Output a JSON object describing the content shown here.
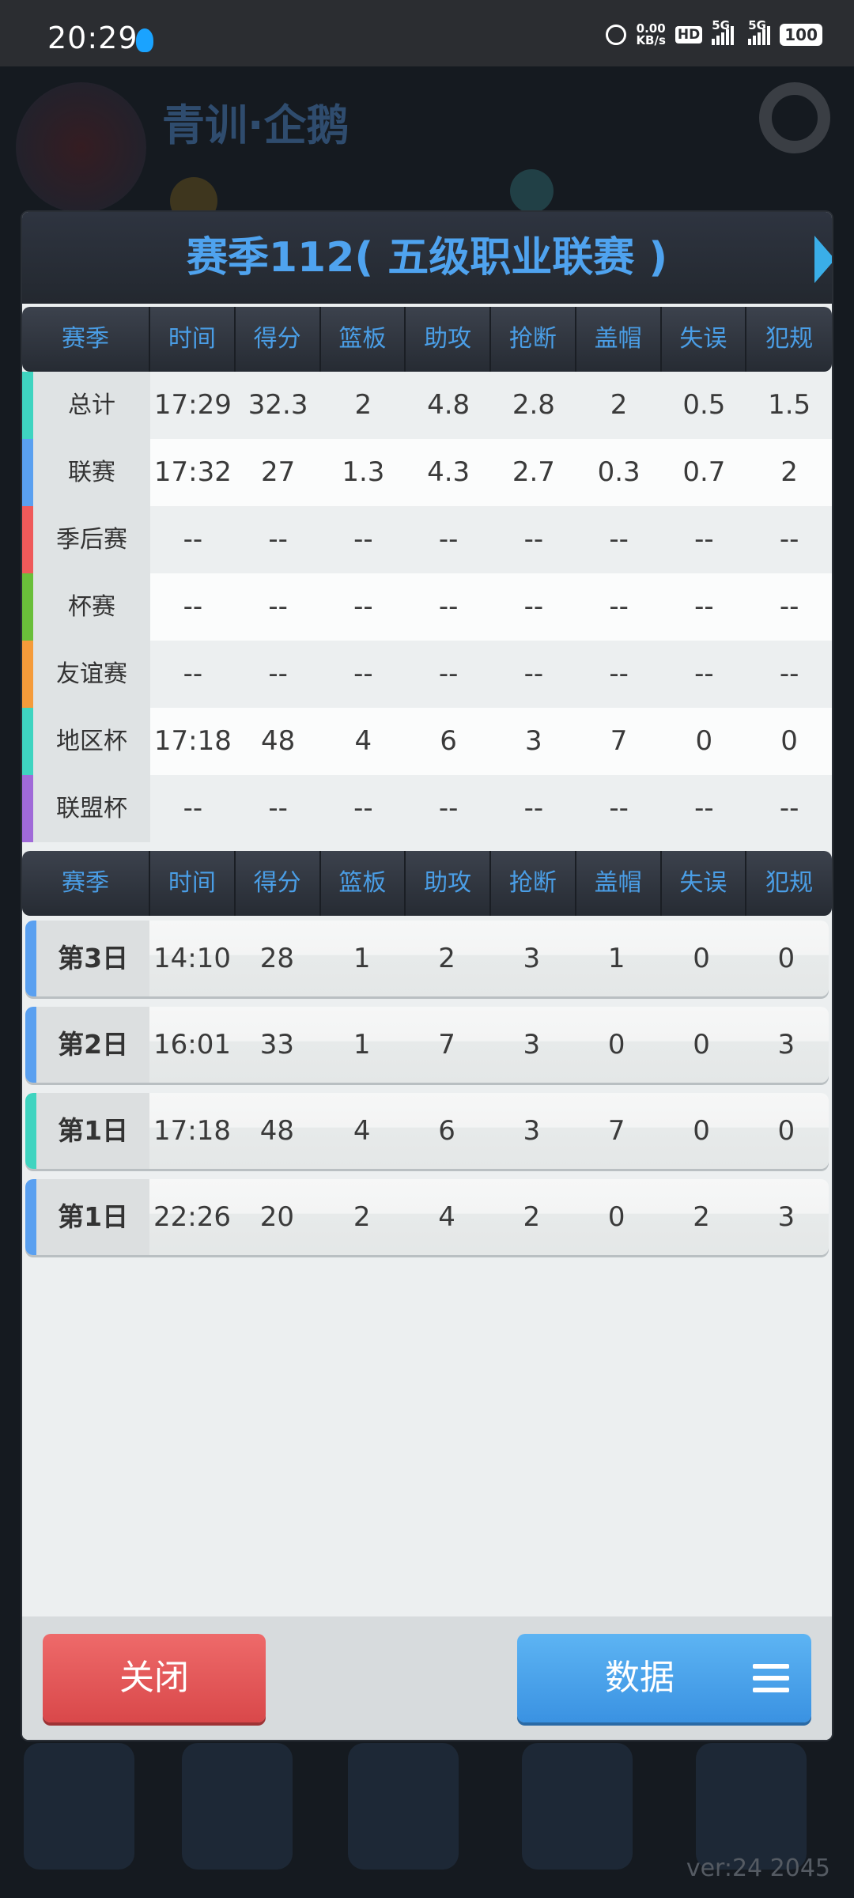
{
  "status_bar": {
    "time": "20:29",
    "net_speed": "0.00",
    "net_unit": "KB/s",
    "hd": "HD",
    "sim1": "5G",
    "sim2": "5G",
    "battery": "100"
  },
  "background": {
    "title": "青训·企鹅",
    "version": "ver:24  2045"
  },
  "dialog": {
    "title": "赛季112( 五级职业联赛 )",
    "columns": [
      "赛季",
      "时间",
      "得分",
      "篮板",
      "助攻",
      "抢断",
      "盖帽",
      "失误",
      "犯规"
    ],
    "summary_rows": [
      {
        "label": "总计",
        "color": "#3fd4c0",
        "values": [
          "17:29",
          "32.3",
          "2",
          "4.8",
          "2.8",
          "2",
          "0.5",
          "1.5"
        ]
      },
      {
        "label": "联赛",
        "color": "#5aa0f0",
        "values": [
          "17:32",
          "27",
          "1.3",
          "4.3",
          "2.7",
          "0.3",
          "0.7",
          "2"
        ]
      },
      {
        "label": "季后赛",
        "color": "#ef5a5a",
        "values": [
          "--",
          "--",
          "--",
          "--",
          "--",
          "--",
          "--",
          "--"
        ]
      },
      {
        "label": "杯赛",
        "color": "#6abf3a",
        "values": [
          "--",
          "--",
          "--",
          "--",
          "--",
          "--",
          "--",
          "--"
        ]
      },
      {
        "label": "友谊赛",
        "color": "#f59b3a",
        "values": [
          "--",
          "--",
          "--",
          "--",
          "--",
          "--",
          "--",
          "--"
        ]
      },
      {
        "label": "地区杯",
        "color": "#3fd4c0",
        "values": [
          "17:18",
          "48",
          "4",
          "6",
          "3",
          "7",
          "0",
          "0"
        ]
      },
      {
        "label": "联盟杯",
        "color": "#a06ad8",
        "values": [
          "--",
          "--",
          "--",
          "--",
          "--",
          "--",
          "--",
          "--"
        ]
      }
    ],
    "game_rows": [
      {
        "label": "第3日",
        "color": "#5aa0f0",
        "values": [
          "14:10",
          "28",
          "1",
          "2",
          "3",
          "1",
          "0",
          "0"
        ]
      },
      {
        "label": "第2日",
        "color": "#5aa0f0",
        "values": [
          "16:01",
          "33",
          "1",
          "7",
          "3",
          "0",
          "0",
          "3"
        ]
      },
      {
        "label": "第1日",
        "color": "#3fd4c0",
        "values": [
          "17:18",
          "48",
          "4",
          "6",
          "3",
          "7",
          "0",
          "0"
        ]
      },
      {
        "label": "第1日",
        "color": "#5aa0f0",
        "values": [
          "22:26",
          "20",
          "2",
          "4",
          "2",
          "0",
          "2",
          "3"
        ]
      }
    ],
    "close_label": "关闭",
    "data_label": "数据"
  }
}
